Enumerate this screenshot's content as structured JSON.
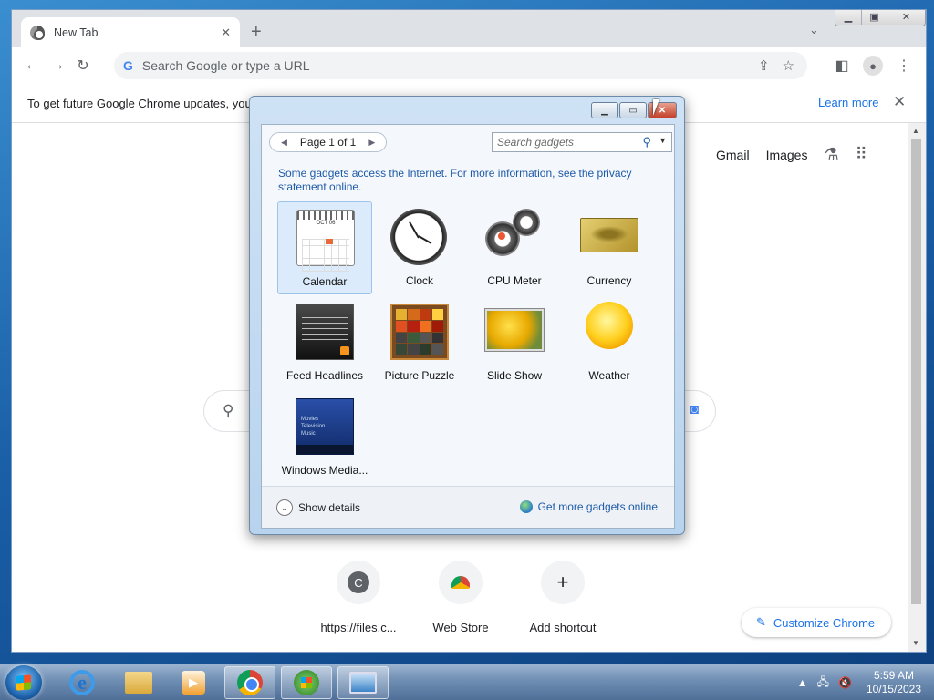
{
  "browser": {
    "tab_title": "New Tab",
    "tab_close": "✕",
    "new_tab": "+",
    "tab_search": "⌄",
    "omnibox_placeholder": "Search Google or type a URL",
    "infobar_text": "To get future Google Chrome updates, you",
    "infobar_link": "Learn more",
    "infobar_close": "✕"
  },
  "ntp": {
    "gmail": "Gmail",
    "images": "Images",
    "shortcuts": [
      {
        "label": "https://files.c...",
        "initial": "C"
      },
      {
        "label": "Web Store"
      },
      {
        "label": "Add shortcut",
        "icon": "+"
      }
    ],
    "customize": "Customize Chrome"
  },
  "gadgets": {
    "page": "Page 1 of 1",
    "search_placeholder": "Search gadgets",
    "notice": "Some gadgets access the Internet.  For more information, see the privacy statement online.",
    "items": [
      {
        "label": "Calendar",
        "month": "OCT 06"
      },
      {
        "label": "Clock"
      },
      {
        "label": "CPU Meter"
      },
      {
        "label": "Currency"
      },
      {
        "label": "Feed Headlines"
      },
      {
        "label": "Picture Puzzle"
      },
      {
        "label": "Slide Show"
      },
      {
        "label": "Weather"
      },
      {
        "label": "Windows Media...",
        "menu": [
          "Movies",
          "Television",
          "Music"
        ]
      }
    ],
    "show_details": "Show details",
    "get_more": "Get more gadgets online"
  },
  "taskbar": {
    "time": "5:59 AM",
    "date": "10/15/2023"
  },
  "colors": {
    "chrome_link": "#1a73e8",
    "win7_link": "#1d5aa8",
    "selected_gadget": "#dcebfb"
  }
}
